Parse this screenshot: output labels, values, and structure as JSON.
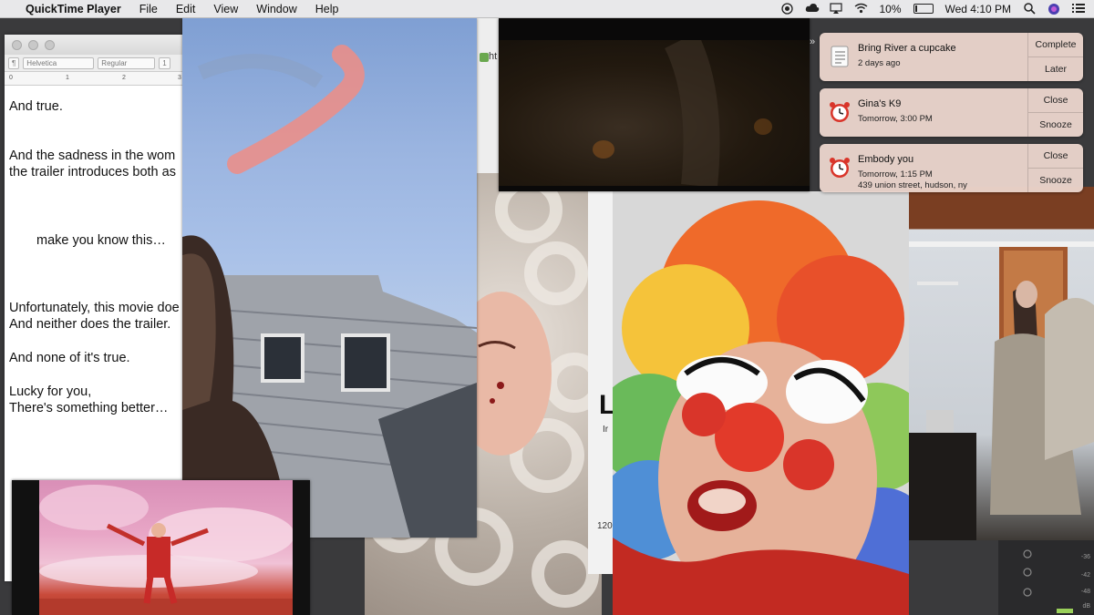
{
  "menubar": {
    "app_name": "QuickTime Player",
    "items": [
      "File",
      "Edit",
      "View",
      "Window",
      "Help"
    ],
    "battery_percent": "10%",
    "battery_level": 0.1,
    "clock": "Wed 4:10 PM"
  },
  "editor": {
    "toolbar": {
      "style_select": "¶",
      "font_select": "Helvetica",
      "weight_select": "Regular",
      "size_select": "1"
    },
    "ruler_ticks": [
      "0",
      "1",
      "2",
      "3"
    ],
    "lines": [
      "And true.",
      "And the sadness in the wom",
      "the trailer introduces both as",
      "make you know this…",
      "Unfortunately, this movie doe",
      "And neither does the trailer.",
      "And none of it's true.",
      "Lucky for you,",
      "There's something better…"
    ]
  },
  "browser": {
    "url_fragment": "ht",
    "heading_fragment": "L",
    "sub_fragment": "Ir",
    "number_fragment": "120"
  },
  "audio_panel": {
    "labels": [
      "-36",
      "-42",
      "-48",
      "dB"
    ]
  },
  "notifications": [
    {
      "title": "Bring River a cupcake",
      "subtitle": "2 days ago",
      "icon": "reminder-list-icon",
      "actions": [
        "Complete",
        "Later"
      ]
    },
    {
      "title": "Gina's K9",
      "subtitle": "Tomorrow, 3:00 PM",
      "icon": "alarm-clock-icon",
      "actions": [
        "Close",
        "Snooze"
      ]
    },
    {
      "title": "Embody you",
      "subtitle": "Tomorrow, 1:15 PM",
      "detail": "439 union street, hudson, ny",
      "icon": "alarm-clock-icon",
      "actions": [
        "Close",
        "Snooze"
      ]
    }
  ],
  "colors": {
    "menubar_bg": "#e8e8ea",
    "notification_bg": "#ecd6ce",
    "alarm_red": "#d9352a"
  }
}
